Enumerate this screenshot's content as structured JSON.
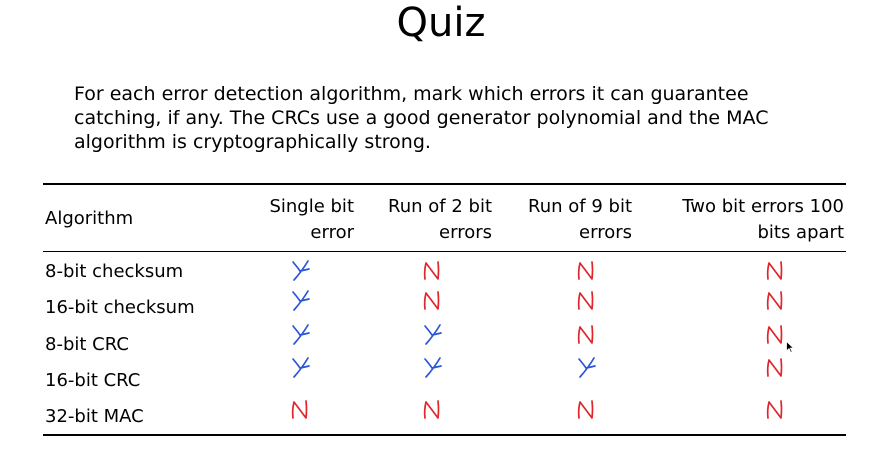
{
  "slide": {
    "title": "Quiz",
    "prompt": "For each error detection algorithm, mark which errors it can guarantee catching, if any. The CRCs use a good generator polynomial and the MAC algorithm is cryptographically strong."
  },
  "table": {
    "columns": [
      {
        "line1": "Algorithm",
        "line2": ""
      },
      {
        "line1": "Single bit",
        "line2": "error"
      },
      {
        "line1": "Run of 2 bit",
        "line2": "errors"
      },
      {
        "line1": "Run of 9 bit",
        "line2": "errors"
      },
      {
        "line1": "Two bit errors 100",
        "line2": "bits apart"
      }
    ],
    "rows": [
      {
        "algorithm": "8-bit checksum",
        "answers": [
          "Y",
          "N",
          "N",
          "N"
        ]
      },
      {
        "algorithm": "16-bit checksum",
        "answers": [
          "Y",
          "N",
          "N",
          "N"
        ]
      },
      {
        "algorithm": "8-bit CRC",
        "answers": [
          "Y",
          "Y",
          "N",
          "N"
        ]
      },
      {
        "algorithm": "16-bit CRC",
        "answers": [
          "Y",
          "Y",
          "Y",
          "N"
        ]
      },
      {
        "algorithm": "32-bit MAC",
        "answers": [
          "N",
          "N",
          "N",
          "N"
        ]
      }
    ]
  },
  "colors": {
    "yes": "#2a55d6",
    "no": "#e0252b"
  },
  "icons": {
    "cursor": "mouse-pointer-icon"
  }
}
